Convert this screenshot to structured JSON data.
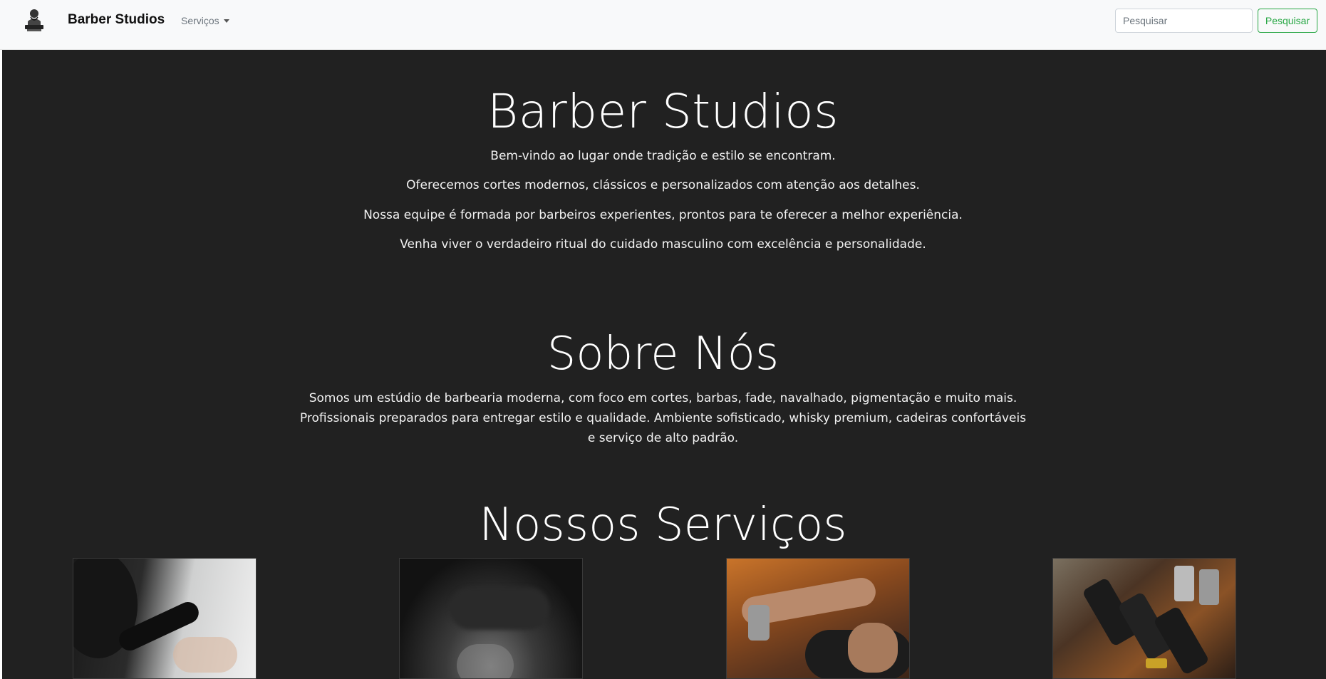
{
  "navbar": {
    "brand_name": "Barber Studios",
    "logo_icon": "barber-logo-icon",
    "dropdown_label": "Serviços",
    "search_placeholder": "Pesquisar",
    "search_button_label": "Pesquisar",
    "search_button_color": "#28a745"
  },
  "hero": {
    "title": "Barber Studios",
    "lines": [
      "Bem-vindo ao lugar onde tradição e estilo se encontram.",
      "Oferecemos cortes modernos, clássicos e personalizados com atenção aos detalhes.",
      "Nossa equipe é formada por barbeiros experientes, prontos para te oferecer a melhor experiência.",
      "Venha viver o verdadeiro ritual do cuidado masculino com excelência e personalidade."
    ]
  },
  "about": {
    "title": "Sobre Nós",
    "text": "Somos um estúdio de barbearia moderna, com foco em cortes, barbas, fade, navalhado, pigmentação e muito mais. Profissionais preparados para entregar estilo e qualidade. Ambiente sofisticado, whisky premium, cadeiras confortáveis e serviço de alto padrão."
  },
  "services": {
    "title": "Nossos Serviços",
    "cards": [
      {
        "image": "barber-haircut-photo"
      },
      {
        "image": "dark-barber-photo"
      },
      {
        "image": "tattooed-barber-photo"
      },
      {
        "image": "clippers-collection-photo"
      }
    ]
  },
  "colors": {
    "background": "#212121",
    "navbar": "#f8f9fa",
    "accent": "#28a745"
  }
}
